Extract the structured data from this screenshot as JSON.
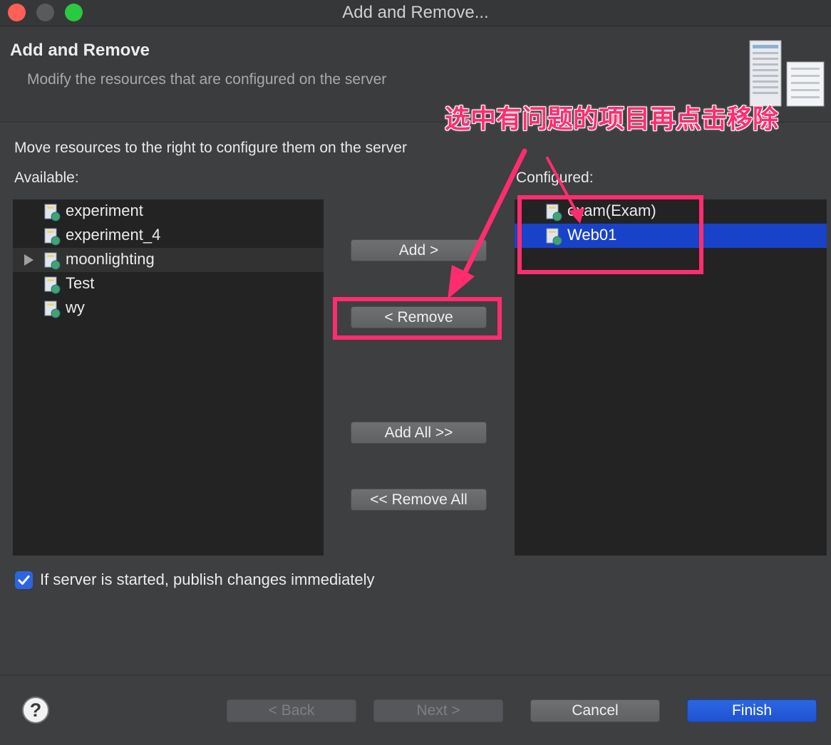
{
  "window": {
    "title": "Add and Remove..."
  },
  "header": {
    "title": "Add and Remove",
    "subtitle": "Modify the resources that are configured on the server"
  },
  "instructions": "Move resources to the right to configure them on the server",
  "available": {
    "label": "Available:",
    "items": [
      {
        "label": "experiment"
      },
      {
        "label": "experiment_4"
      },
      {
        "label": "moonlighting"
      },
      {
        "label": "Test"
      },
      {
        "label": "wy"
      }
    ]
  },
  "configured": {
    "label": "Configured:",
    "items": [
      {
        "label": "exam(Exam)"
      },
      {
        "label": "Web01"
      }
    ]
  },
  "buttons": {
    "add": "Add >",
    "remove": "< Remove",
    "add_all": "Add All >>",
    "remove_all": "<< Remove All"
  },
  "publish": {
    "label": "If server is started, publish changes immediately",
    "checked": true
  },
  "footer": {
    "help": "?",
    "back": "< Back",
    "next": "Next >",
    "cancel": "Cancel",
    "finish": "Finish"
  },
  "annotation": {
    "text": "选中有问题的项目再点击移除",
    "color": "#ff2d6f"
  },
  "colors": {
    "accent": "#1842c8",
    "highlight": "#ff2d6f"
  }
}
